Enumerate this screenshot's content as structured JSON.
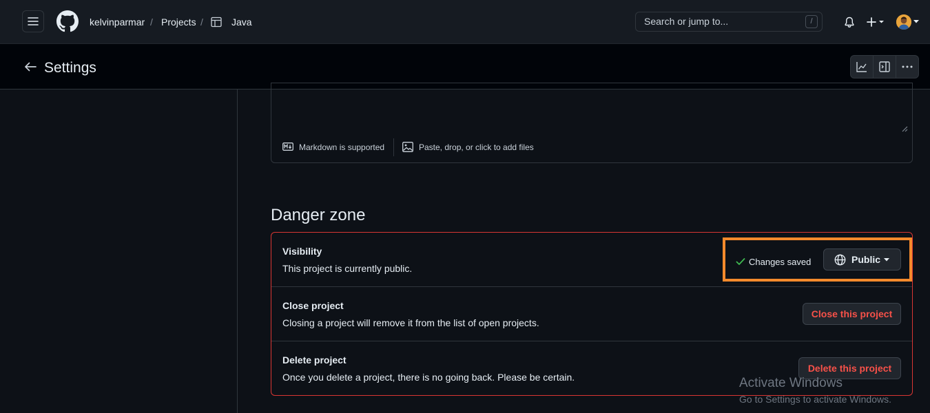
{
  "header": {
    "breadcrumb": {
      "owner": "kelvinparmar",
      "section": "Projects",
      "separator": "/",
      "project": "Java"
    },
    "search": {
      "placeholder": "Search or jump to...",
      "shortcut": "/"
    },
    "icons": [
      "menu-icon",
      "github-logo-icon",
      "table-icon",
      "bell-icon",
      "plus-icon",
      "avatar"
    ]
  },
  "settings_bar": {
    "title": "Settings",
    "actions": [
      "insights-icon",
      "sidebar-panel-icon",
      "kebab-icon"
    ]
  },
  "editor_footer": {
    "markdown_label": "Markdown is supported",
    "attach_label": "Paste, drop, or click to add files"
  },
  "danger_zone": {
    "title": "Danger zone",
    "rows": [
      {
        "title": "Visibility",
        "description": "This project is currently public.",
        "status": "Changes saved",
        "button": "Public"
      },
      {
        "title": "Close project",
        "description": "Closing a project will remove it from the list of open projects.",
        "button": "Close this project"
      },
      {
        "title": "Delete project",
        "description": "Once you delete a project, there is no going back. Please be certain.",
        "button": "Delete this project"
      }
    ]
  },
  "watermark": {
    "title": "Activate Windows",
    "subtitle": "Go to Settings to activate Windows."
  },
  "colors": {
    "background": "#0d1117",
    "danger": "#da3633",
    "danger_text": "#f85149",
    "highlight": "#f48a2c",
    "success": "#3fb950"
  }
}
